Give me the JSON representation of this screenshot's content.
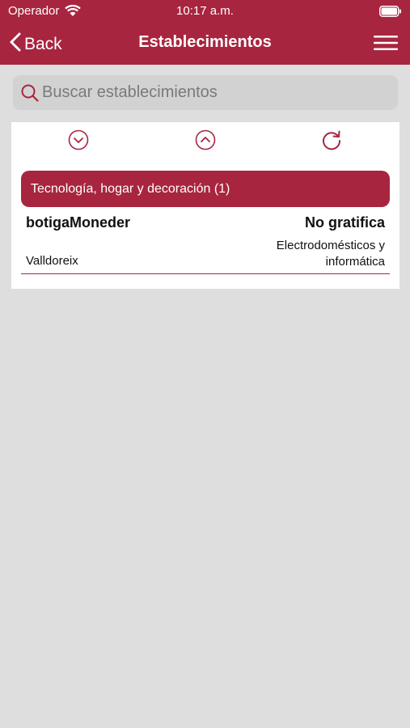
{
  "status_bar": {
    "carrier": "Operador",
    "time": "10:17 a.m."
  },
  "nav": {
    "back_label": "Back",
    "title": "Establecimientos"
  },
  "search": {
    "placeholder": "Buscar establecimientos"
  },
  "category": {
    "label": "Tecnología, hogar y decoración (1)"
  },
  "items": [
    {
      "name": "botigaMoneder",
      "status": "No gratifica",
      "location": "Valldoreix",
      "type": "Electrodomésticos y informática"
    }
  ],
  "colors": {
    "accent": "#a8253f",
    "background": "#dedede"
  }
}
